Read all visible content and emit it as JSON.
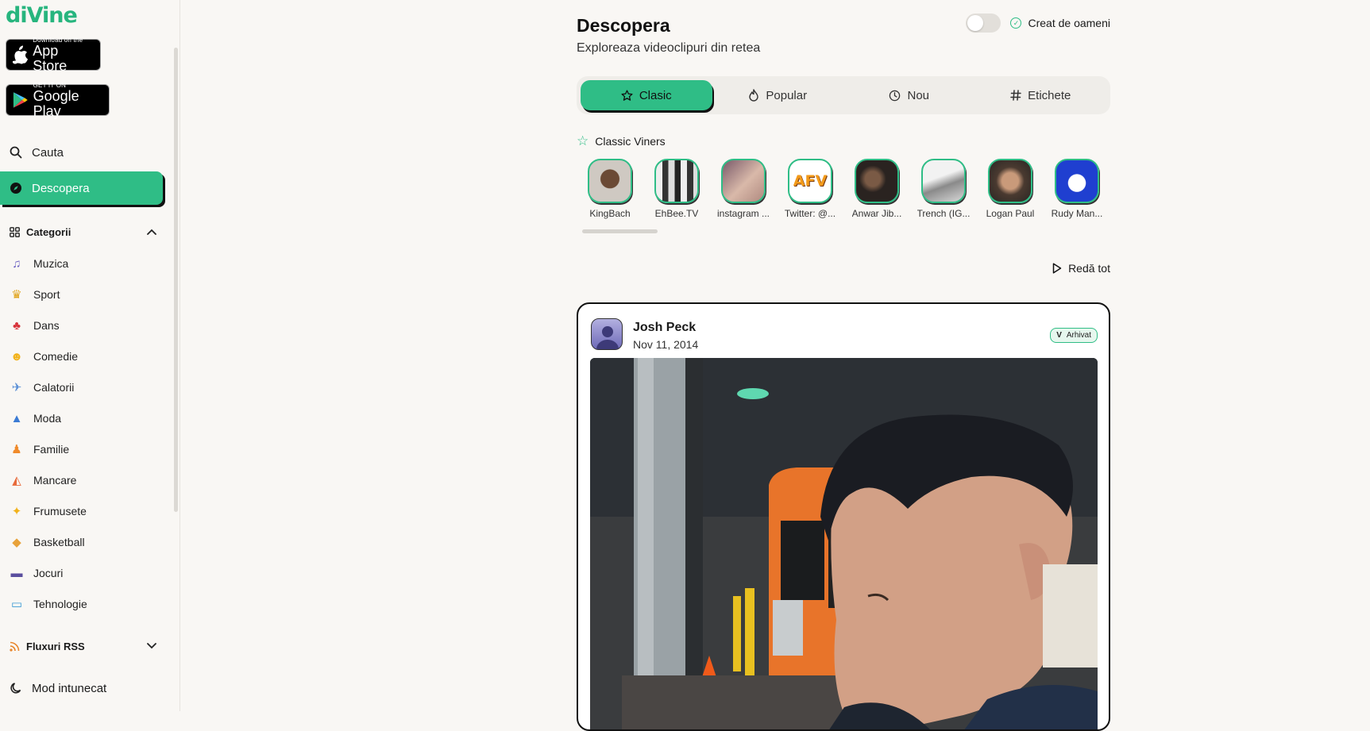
{
  "sidebar": {
    "logo": "diVine",
    "app_store": {
      "small": "Download on the",
      "big": "App Store"
    },
    "google_play": {
      "small": "GET IT ON",
      "big": "Google Play"
    },
    "search_label": "Cauta",
    "discover_label": "Descopera",
    "categories_label": "Categorii",
    "categories": [
      {
        "label": "Muzica",
        "icon": "music-note-icon"
      },
      {
        "label": "Sport",
        "icon": "trophy-icon"
      },
      {
        "label": "Dans",
        "icon": "dancer-icon"
      },
      {
        "label": "Comedie",
        "icon": "laughing-face-icon"
      },
      {
        "label": "Calatorii",
        "icon": "airplane-icon"
      },
      {
        "label": "Moda",
        "icon": "dress-icon"
      },
      {
        "label": "Familie",
        "icon": "family-icon"
      },
      {
        "label": "Mancare",
        "icon": "pizza-icon"
      },
      {
        "label": "Frumusete",
        "icon": "sparkles-icon"
      },
      {
        "label": "Basketball",
        "icon": "basketball-icon"
      },
      {
        "label": "Jocuri",
        "icon": "gamepad-icon"
      },
      {
        "label": "Tehnologie",
        "icon": "computer-icon"
      }
    ],
    "rss_label": "Fluxuri RSS",
    "dark_mode_label": "Mod intunecat"
  },
  "header": {
    "title": "Descopera",
    "subtitle": "Exploreaza videoclipuri din retea",
    "toggle_label": "Creat de oameni"
  },
  "tabs": [
    {
      "label": "Clasic",
      "icon": "star-icon",
      "active": true
    },
    {
      "label": "Popular",
      "icon": "flame-icon",
      "active": false
    },
    {
      "label": "Nou",
      "icon": "clock-icon",
      "active": false
    },
    {
      "label": "Etichete",
      "icon": "hashtag-icon",
      "active": false
    }
  ],
  "classic_viners": {
    "label": "Classic Viners",
    "items": [
      {
        "name": "KingBach"
      },
      {
        "name": "EhBee.TV"
      },
      {
        "name": "instagram ..."
      },
      {
        "name": "Twitter: @..."
      },
      {
        "name": "Anwar Jib..."
      },
      {
        "name": "Trench (IG..."
      },
      {
        "name": "Logan Paul"
      },
      {
        "name": "Rudy Man..."
      }
    ]
  },
  "play_all_label": "Redă tot",
  "post": {
    "author": "Josh Peck",
    "date": "Nov 11, 2014",
    "badge_v": "V",
    "badge_label": "Arhivat"
  },
  "colors": {
    "accent": "#2fbd86",
    "background": "#f9f7f4"
  }
}
